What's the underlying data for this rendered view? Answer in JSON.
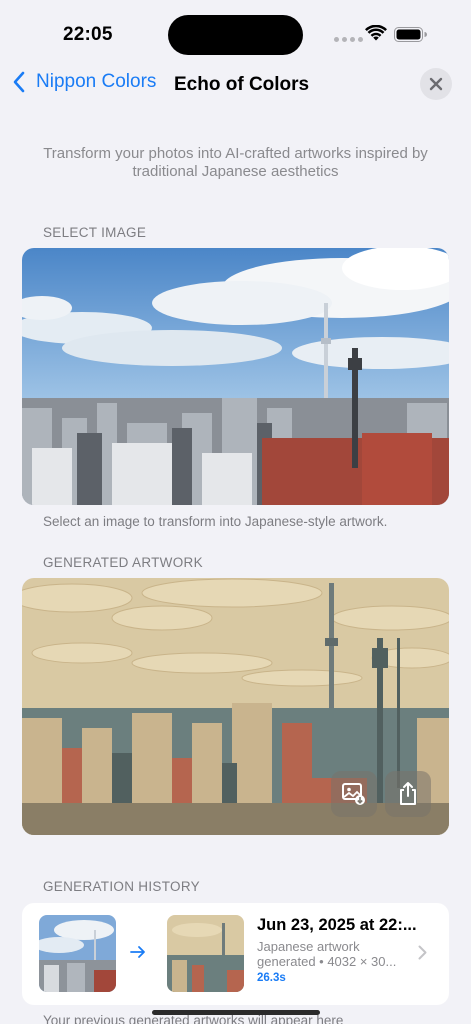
{
  "status_bar": {
    "time": "22:05"
  },
  "nav": {
    "back_label": "Nippon Colors",
    "title": "Echo of Colors"
  },
  "intro_text": "Transform your photos into AI-crafted artworks inspired by traditional Japanese aesthetics",
  "select_section": {
    "label": "SELECT IMAGE",
    "caption": "Select an image to transform into Japanese-style artwork."
  },
  "generated_section": {
    "label": "GENERATED ARTWORK"
  },
  "history_section": {
    "label": "GENERATION HISTORY",
    "items": [
      {
        "date": "Jun 23, 2025 at 22:...",
        "desc_line1": "Japanese artwork",
        "desc_line2": "generated • 4032 × 30...",
        "duration": "26.3s"
      }
    ],
    "footer": "Your previous generated artworks will appear here"
  },
  "icons": {
    "back": "chevron-left-icon",
    "close": "close-icon",
    "save_image": "save-photo-icon",
    "share": "share-icon",
    "arrow": "arrow-right-icon",
    "chevron": "chevron-right-icon"
  },
  "colors": {
    "accent": "#1a7cf5",
    "background": "#f2f2f7",
    "secondary_text": "#7d7d82"
  }
}
